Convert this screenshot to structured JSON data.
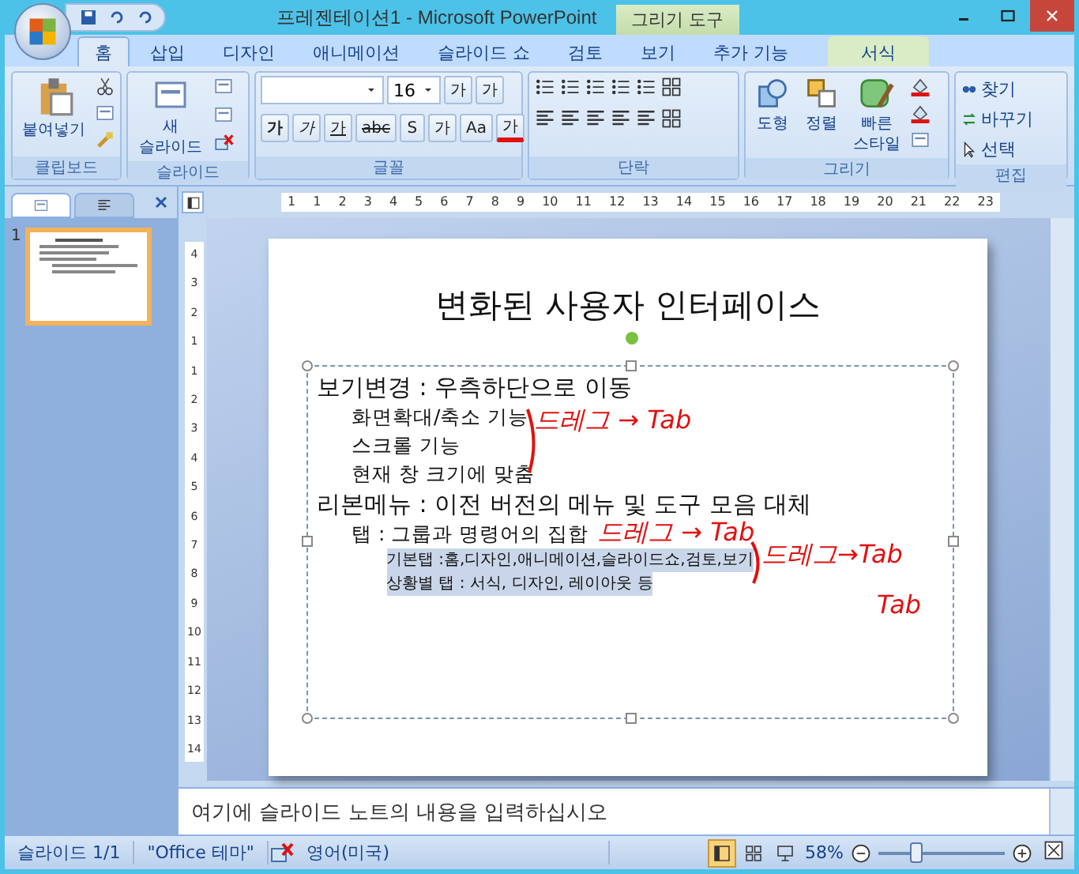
{
  "title_bar": {
    "title": "프레젠테이션1 - Microsoft PowerPoint",
    "contextual_tab": "그리기 도구"
  },
  "ribbon_tabs": [
    {
      "label": "홈",
      "selected": true
    },
    {
      "label": "삽입",
      "selected": false
    },
    {
      "label": "디자인",
      "selected": false
    },
    {
      "label": "애니메이션",
      "selected": false
    },
    {
      "label": "슬라이드 쇼",
      "selected": false
    },
    {
      "label": "검토",
      "selected": false
    },
    {
      "label": "보기",
      "selected": false
    },
    {
      "label": "추가 기능",
      "selected": false
    },
    {
      "label": "서식",
      "selected": false,
      "kind": "contextual"
    }
  ],
  "ribbon": {
    "clipboard": {
      "paste": "붙여넣기",
      "label": "클립보드"
    },
    "slides": {
      "new_slide": "새 슬라이드",
      "label": "슬라이드"
    },
    "font": {
      "font_size": "16",
      "grow": "가",
      "shrink": "가",
      "format_buttons": [
        "가",
        "가",
        "가",
        "abc",
        "S",
        "가",
        "Aa"
      ],
      "color_button": "가",
      "label": "글꼴"
    },
    "paragraph": {
      "label": "단락"
    },
    "drawing": {
      "buttons": [
        "도형",
        "정렬",
        "빠른 스타일"
      ],
      "label": "그리기"
    },
    "editing": {
      "buttons": [
        "찾기",
        "바꾸기",
        "선택"
      ],
      "label": "편집"
    }
  },
  "ruler": {
    "horizontal": [
      "1",
      "1",
      "2",
      "3",
      "4",
      "5",
      "6",
      "7",
      "8",
      "9",
      "10",
      "11",
      "12",
      "13",
      "14",
      "15",
      "16",
      "17",
      "18",
      "19",
      "20",
      "21",
      "22",
      "23"
    ],
    "vertical": [
      "4",
      "3",
      "2",
      "1",
      "1",
      "2",
      "3",
      "4",
      "5",
      "6",
      "7",
      "8",
      "9",
      "10",
      "11",
      "12",
      "13",
      "14"
    ]
  },
  "thumbnails": [
    {
      "number": "1",
      "selected": true
    }
  ],
  "slide": {
    "title": "변화된 사용자 인터페이스",
    "bullets": [
      {
        "text": "보기변경 : 우측하단으로 이동",
        "selected": false,
        "children": [
          {
            "text": "화면확대/축소 기능",
            "selected": false
          },
          {
            "text": "스크롤 기능",
            "selected": false
          },
          {
            "text": "현재 창 크기에 맞춤",
            "selected": false
          }
        ]
      },
      {
        "text": "리본메뉴 : 이전 버전의 메뉴 및 도구 모음 대체",
        "selected": false,
        "children": [
          {
            "text": "탭 : 그룹과 명령어의 집합",
            "selected": false,
            "children": [
              {
                "text": "기본탭 :홈,디자인,애니메이션,슬라이드쇼,검토,보기",
                "selected": true
              },
              {
                "text": "상황별 탭 : 서식, 디자인, 레이아웃 등",
                "selected": true
              }
            ]
          }
        ]
      }
    ],
    "ink_notes": [
      "드레그 → Tab",
      "드레그 → Tab",
      "드레그→Tab",
      "Tab"
    ]
  },
  "notes": {
    "placeholder": "여기에 슬라이드 노트의 내용을 입력하십시오"
  },
  "status_bar": {
    "slide": "슬라이드 1/1",
    "theme": "\"Office 테마\"",
    "language": "영어(미국)",
    "views": [
      {
        "selected": true
      },
      {
        "selected": false
      },
      {
        "selected": false
      }
    ],
    "zoom": "58%",
    "level": 0.3
  }
}
